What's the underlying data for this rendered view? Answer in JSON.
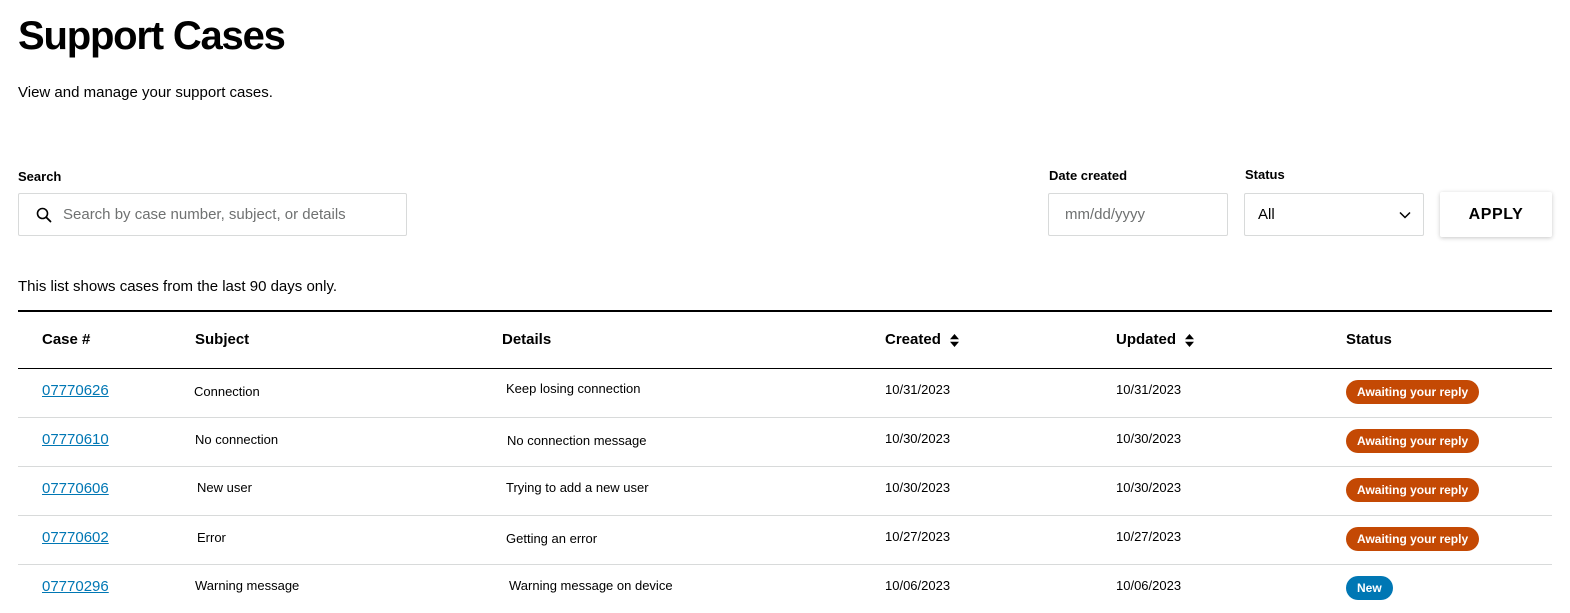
{
  "header": {
    "title": "Support Cases",
    "subtitle": "View and manage your support cases."
  },
  "filters": {
    "search": {
      "label": "Search",
      "placeholder": "Search by case number, subject, or details",
      "value": ""
    },
    "date_created": {
      "label": "Date created",
      "placeholder": "mm/dd/yyyy",
      "value": ""
    },
    "status": {
      "label": "Status",
      "selected": "All"
    },
    "apply_label": "APPLY"
  },
  "list_note": "This list shows cases from the last 90 days only.",
  "table": {
    "columns": [
      "Case #",
      "Subject",
      "Details",
      "Created",
      "Updated",
      "Status"
    ],
    "rows": [
      {
        "case": "07770626",
        "subject": "Connection",
        "details": "Keep losing connection",
        "created": "10/31/2023",
        "updated": "10/31/2023",
        "status": "Awaiting your reply",
        "status_type": "awaiting"
      },
      {
        "case": "07770610",
        "subject": "No connection",
        "details": "No connection message",
        "created": "10/30/2023",
        "updated": "10/30/2023",
        "status": "Awaiting your reply",
        "status_type": "awaiting"
      },
      {
        "case": "07770606",
        "subject": "New user",
        "details": "Trying to add a new user",
        "created": "10/30/2023",
        "updated": "10/30/2023",
        "status": "Awaiting your reply",
        "status_type": "awaiting"
      },
      {
        "case": "07770602",
        "subject": "Error",
        "details": "Getting an error",
        "created": "10/27/2023",
        "updated": "10/27/2023",
        "status": "Awaiting your reply",
        "status_type": "awaiting"
      },
      {
        "case": "07770296",
        "subject": "Warning message",
        "details": "Warning message on device",
        "created": "10/06/2023",
        "updated": "10/06/2023",
        "status": "New",
        "status_type": "new"
      }
    ]
  },
  "colors": {
    "link": "#0077b4",
    "status_awaiting": "#c44904",
    "status_new": "#0077b4"
  },
  "icons": {
    "search": "search-icon",
    "select": "chevron-down-icon",
    "sort": "sort-icon"
  }
}
